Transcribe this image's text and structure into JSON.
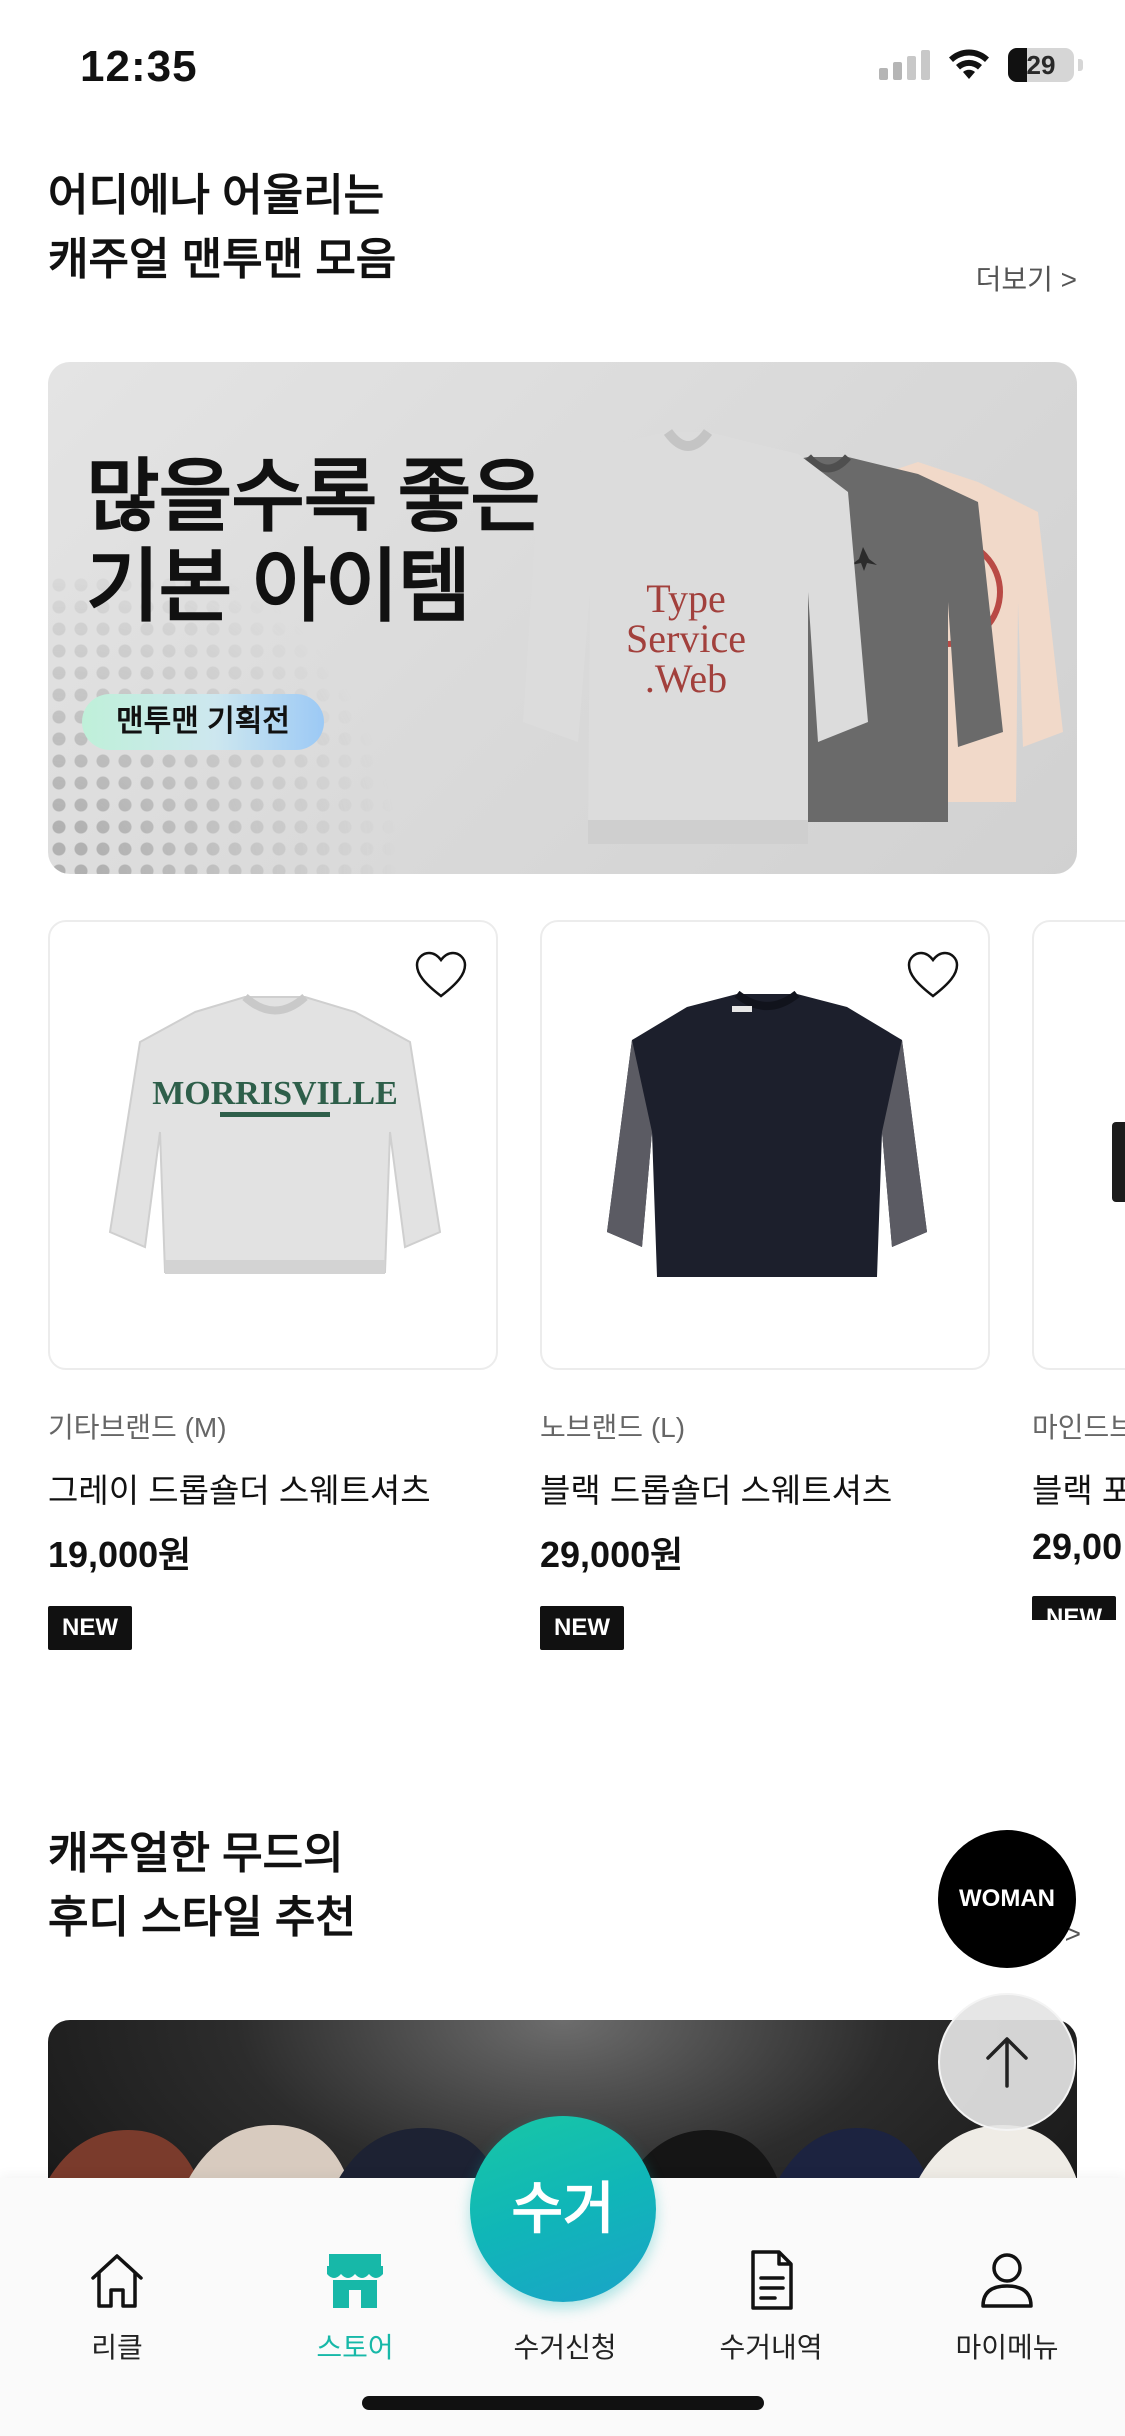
{
  "status_bar": {
    "time": "12:35",
    "battery": "29",
    "battery_level": 0.29
  },
  "section1": {
    "title_lines": [
      "어디에나 어울리는",
      "캐주얼 맨투맨 모음"
    ],
    "more_label": "더보기 >"
  },
  "banner": {
    "headline_lines": [
      "많을수록 좋은",
      "기본 아이템"
    ],
    "chip_label": "맨투맨 기획전",
    "print_text_lines": [
      "Type",
      "Service",
      ".Web"
    ]
  },
  "products": [
    {
      "brand": "기타브랜드 (M)",
      "name": "그레이 드롭숄더 스웨트셔츠",
      "price": "19,000원",
      "badge": "NEW",
      "print_text": "MORRISVILLE",
      "color": "#e2e2e2"
    },
    {
      "brand": "노브랜드 (L)",
      "name": "블랙 드롭숄더 스웨트셔츠",
      "price": "29,000원",
      "badge": "NEW",
      "color": "#1c1f2c"
    },
    {
      "brand": "마인드브",
      "name": "블랙 포",
      "price": "29,00",
      "badge": "NEW"
    }
  ],
  "section2": {
    "title_lines": [
      "캐주얼한 무드의",
      "후디 스타일 추천"
    ],
    "more_label": ">"
  },
  "floating": {
    "woman_label": "WOMAN",
    "scroll_top_icon": "arrow-up-icon"
  },
  "tab_bar": {
    "items": [
      {
        "label": "리클",
        "icon": "home-icon"
      },
      {
        "label": "스토어",
        "icon": "store-icon",
        "active": true
      },
      {
        "label": "수거신청",
        "icon": "collect-button"
      },
      {
        "label": "수거내역",
        "icon": "document-icon"
      },
      {
        "label": "마이메뉴",
        "icon": "person-icon"
      }
    ],
    "collect_button_label": "수거"
  },
  "colors": {
    "accent": "#17b8a8",
    "text": "#111111",
    "chip_gradient_start": "#bff0d9",
    "chip_gradient_end": "#9cc9f5"
  }
}
